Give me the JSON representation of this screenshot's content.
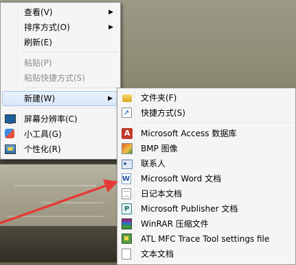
{
  "context_menu": {
    "items": [
      {
        "label": "查看(V)",
        "submenu": true,
        "disabled": false
      },
      {
        "label": "排序方式(O)",
        "submenu": true,
        "disabled": false
      },
      {
        "label": "刷新(E)",
        "submenu": false,
        "disabled": false
      },
      {
        "label": "粘贴(P)",
        "submenu": false,
        "disabled": true
      },
      {
        "label": "粘贴快捷方式(S)",
        "submenu": false,
        "disabled": true
      },
      {
        "label": "新建(W)",
        "submenu": true,
        "disabled": false,
        "highlighted": true
      },
      {
        "label": "屏幕分辨率(C)",
        "submenu": false,
        "disabled": false,
        "icon": "screen-resolution-icon"
      },
      {
        "label": "小工具(G)",
        "submenu": false,
        "disabled": false,
        "icon": "gadgets-icon"
      },
      {
        "label": "个性化(R)",
        "submenu": false,
        "disabled": false,
        "icon": "personalize-icon"
      }
    ]
  },
  "new_submenu": {
    "items": [
      {
        "label": "文件夹(F)",
        "icon": "folder-icon"
      },
      {
        "label": "快捷方式(S)",
        "icon": "shortcut-icon"
      },
      {
        "label": "Microsoft Access 数据库",
        "icon": "access-icon"
      },
      {
        "label": "BMP 图像",
        "icon": "bmp-image-icon"
      },
      {
        "label": "联系人",
        "icon": "contact-icon"
      },
      {
        "label": "Microsoft Word 文档",
        "icon": "word-document-icon"
      },
      {
        "label": "日记本文档",
        "icon": "journal-icon"
      },
      {
        "label": "Microsoft Publisher 文档",
        "icon": "publisher-icon"
      },
      {
        "label": "WinRAR 压缩文件",
        "icon": "winrar-icon"
      },
      {
        "label": "ATL MFC Trace Tool settings file",
        "icon": "atl-trace-icon"
      },
      {
        "label": "文本文档",
        "icon": "text-document-icon"
      }
    ]
  },
  "colors": {
    "menu_bg": "#f5f5f5",
    "highlight": "#d9e7f8",
    "annotation_arrow": "#e53935"
  }
}
